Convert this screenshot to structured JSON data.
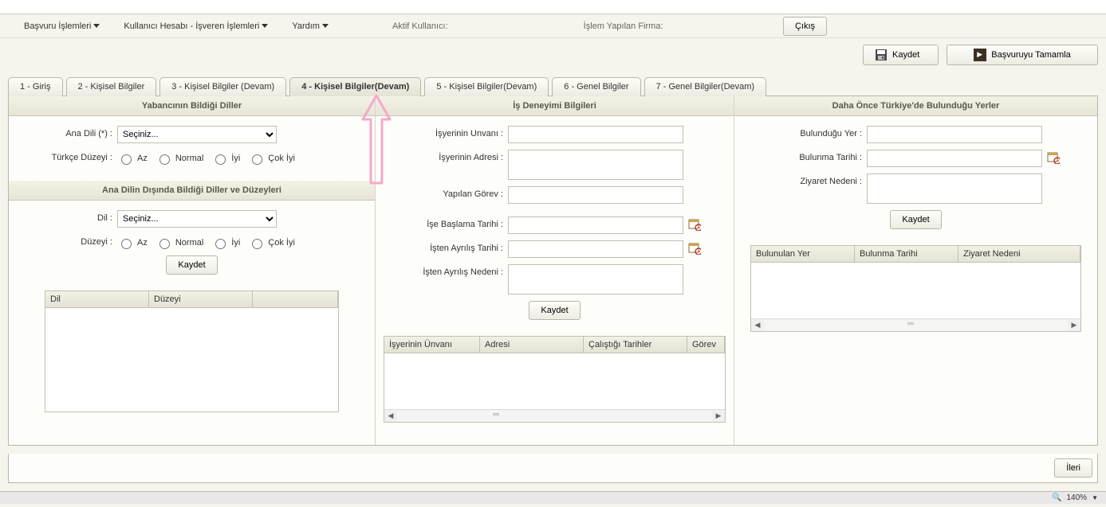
{
  "menubar": {
    "items": [
      "Başvuru İşlemleri",
      "Kullanıcı Hesabı - İşveren İşlemleri",
      "Yardım"
    ],
    "active_user_label": "Aktif Kullanıcı:",
    "firm_label": "İşlem Yapılan Firma:",
    "logout": "Çıkış"
  },
  "actions": {
    "save": "Kaydet",
    "complete": "Başvuruyu Tamamla"
  },
  "tabs": [
    "1 - Giriş",
    "2 - Kişisel Bilgiler",
    "3 - Kişisel Bilgiler (Devam)",
    "4 - Kişisel Bilgiler(Devam)",
    "5 - Kişisel Bilgiler(Devam)",
    "6 - Genel Bilgiler",
    "7 - Genel Bilgiler(Devam)"
  ],
  "active_tab_index": 3,
  "col1": {
    "section1_title": "Yabancının Bildiği Diller",
    "native_lang_label": "Ana Dili (*) :",
    "select_placeholder": "Seçiniz...",
    "turkish_level_label": "Türkçe Düzeyi :",
    "levels": [
      "Az",
      "Normal",
      "İyi",
      "Çok İyi"
    ],
    "section2_title": "Ana Dilin Dışında Bildiği Diller ve Düzeyleri",
    "lang_label": "Dil :",
    "level_label": "Düzeyi :",
    "save_btn": "Kaydet",
    "grid_cols": [
      "Dil",
      "Düzeyi",
      ""
    ]
  },
  "col2": {
    "title": "İş Deneyimi Bilgileri",
    "company_name": "İşyerinin Unvanı :",
    "company_addr": "İşyerinin Adresi :",
    "role": "Yapılan Görev :",
    "start_date": "İşe Başlama Tarihi :",
    "end_date": "İşten Ayrılış Tarihi :",
    "leave_reason": "İşten Ayrılış Nedeni :",
    "save_btn": "Kaydet",
    "grid_cols": [
      "İşyerinin Ünvanı",
      "Adresi",
      "Çalıştığı Tarihler",
      "Görev"
    ]
  },
  "col3": {
    "title": "Daha Önce Türkiye'de Bulunduğu Yerler",
    "place": "Bulunduğu Yer :",
    "date": "Bulunma Tarihi :",
    "reason": "Ziyaret Nedeni :",
    "save_btn": "Kaydet",
    "grid_cols": [
      "Bulunulan Yer",
      "Bulunma Tarihi",
      "Ziyaret Nedeni"
    ]
  },
  "footer": {
    "next": "İleri"
  },
  "status": {
    "zoom": "140%"
  }
}
